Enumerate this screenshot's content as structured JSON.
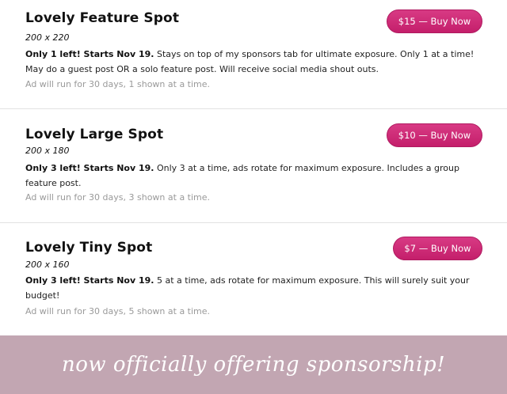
{
  "listings": [
    {
      "title": "Lovely Feature Spot",
      "size": "200 x 220",
      "highlight": "Only 1 left! Starts Nov 19.",
      "description": "  Stays on top of my sponsors tab for ultimate exposure. Only 1 at a time! May do a guest post OR a solo feature post. Will receive social media shout outs.",
      "run_info": "Ad will run for 30 days, 1 shown at a time.",
      "button_label": "$15 — Buy Now"
    },
    {
      "title": "Lovely Large Spot",
      "size": "200 x 180",
      "highlight": "Only 3 left! Starts Nov 19.",
      "description": "  Only 3 at a time, ads rotate for maximum exposure. Includes a group feature post.",
      "run_info": "Ad will run for 30 days, 3 shown at a time.",
      "button_label": "$10 — Buy Now"
    },
    {
      "title": "Lovely Tiny Spot",
      "size": "200 x 160",
      "highlight": "Only 3 left! Starts Nov 19.",
      "description": "  5 at a time, ads rotate for maximum exposure. This will surely suit your budget!",
      "run_info": "Ad will run for 30 days, 5 shown at a time.",
      "button_label": "$7 — Buy Now"
    }
  ],
  "banner": {
    "text": "now officially offering sponsorship!"
  },
  "colors": {
    "button": "#c9266f",
    "banner_bg": "#c2a6b2",
    "muted_text": "#9a9a9a"
  }
}
